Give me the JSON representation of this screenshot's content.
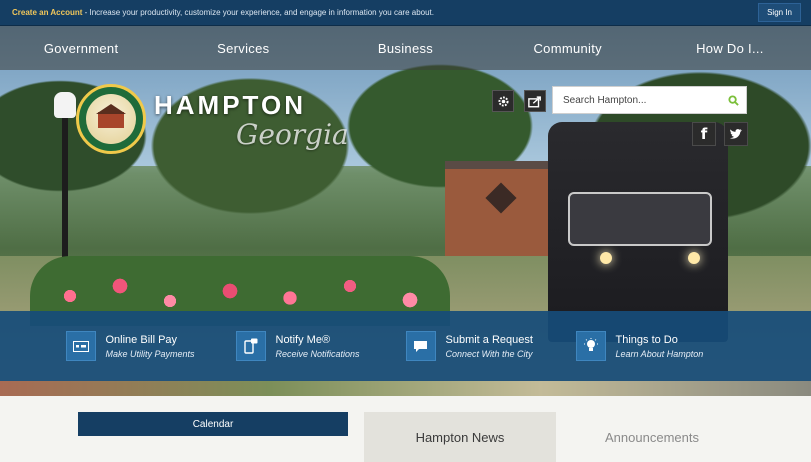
{
  "topbar": {
    "create_account": "Create an Account",
    "promo_text": " - Increase your productivity, customize your experience, and engage in information you care about.",
    "sign_in": "Sign In"
  },
  "nav": {
    "items": [
      {
        "label": "Government"
      },
      {
        "label": "Services"
      },
      {
        "label": "Business"
      },
      {
        "label": "Community"
      },
      {
        "label": "How Do I..."
      }
    ]
  },
  "brand": {
    "name": "HAMPTON",
    "state": "Georgia"
  },
  "search": {
    "placeholder": "Search Hampton..."
  },
  "icons": {
    "settings": "gear-icon",
    "share": "share-icon",
    "search": "search-icon",
    "facebook": "facebook-icon",
    "twitter": "twitter-icon"
  },
  "quick_links": [
    {
      "title": "Online Bill Pay",
      "subtitle": "Make Utility Payments",
      "icon": "bill-pay-icon"
    },
    {
      "title": "Notify Me®",
      "subtitle": "Receive Notifications",
      "icon": "notify-icon"
    },
    {
      "title": "Submit a Request",
      "subtitle": "Connect With the City",
      "icon": "request-icon"
    },
    {
      "title": "Things to Do",
      "subtitle": "Learn About Hampton",
      "icon": "lightbulb-icon"
    }
  ],
  "lower": {
    "calendar_label": "Calendar",
    "tabs": [
      {
        "label": "Hampton News",
        "active": true
      },
      {
        "label": "Announcements",
        "active": false
      }
    ]
  },
  "colors": {
    "primary_navy": "#153e63",
    "quicklink_blue": "#164c7a",
    "search_accent": "#7bbf3a",
    "create_link": "#f1c75b"
  }
}
